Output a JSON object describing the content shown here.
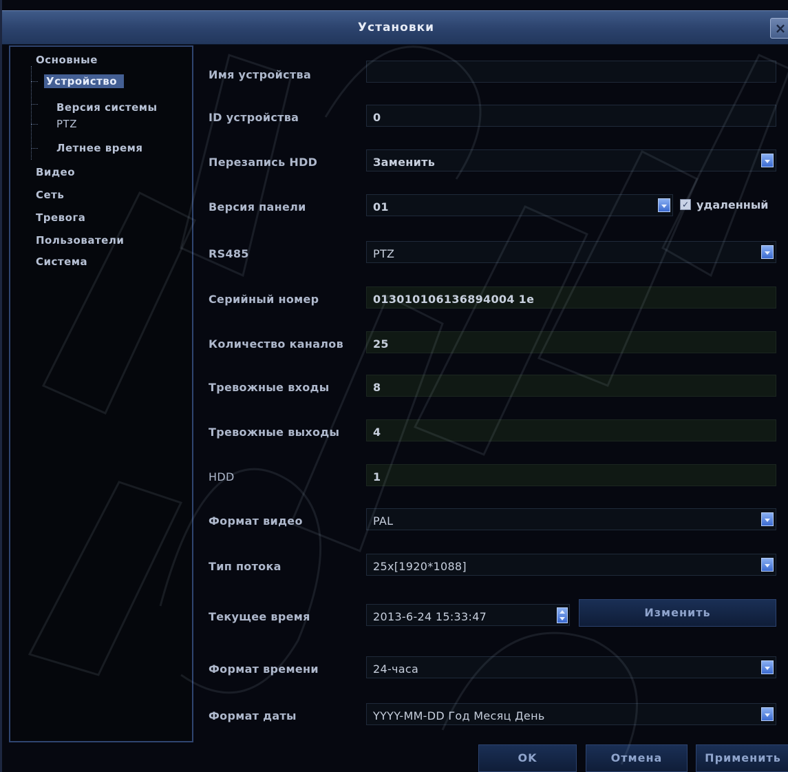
{
  "window": {
    "title": "Установки",
    "close_symbol": "×"
  },
  "sidebar": {
    "items": [
      {
        "label": "Основные"
      },
      {
        "label": "Устройство"
      },
      {
        "label": "Версия системы"
      },
      {
        "label": "PTZ"
      },
      {
        "label": "Летнее время"
      },
      {
        "label": "Видео"
      },
      {
        "label": "Сеть"
      },
      {
        "label": "Тревога"
      },
      {
        "label": "Пользователи"
      },
      {
        "label": "Система"
      }
    ]
  },
  "form": {
    "device_name": {
      "label": "Имя устройства",
      "value": ""
    },
    "device_id": {
      "label": "ID устройства",
      "value": "0"
    },
    "hdd_overwrite": {
      "label": "Перезапись HDD",
      "value": "Заменить"
    },
    "panel_version": {
      "label": "Версия панели",
      "value": "01",
      "remote_label": "удаленный",
      "remote_checked": true
    },
    "rs485": {
      "label": "RS485",
      "value": "PTZ"
    },
    "serial": {
      "label": "Серийный номер",
      "value": "013010106136894004 1e"
    },
    "channels": {
      "label": "Количество каналов",
      "value": "25"
    },
    "alarm_in": {
      "label": "Тревожные входы",
      "value": "8"
    },
    "alarm_out": {
      "label": "Тревожные выходы",
      "value": "4"
    },
    "hdd": {
      "label": "HDD",
      "value": "1"
    },
    "video_format": {
      "label": "Формат видео",
      "value": "PAL"
    },
    "stream_type": {
      "label": "Тип потока",
      "value": "25x[1920*1088]"
    },
    "current_time": {
      "label": "Текущее время",
      "value": "2013-6-24 15:33:47",
      "change_label": "Изменить"
    },
    "time_format": {
      "label": "Формат времени",
      "value": "24-часа"
    },
    "date_format": {
      "label": "Формат даты",
      "value": "YYYY-MM-DD Год Месяц День"
    }
  },
  "footer": {
    "ok_label": "OK",
    "cancel_label": "Отмена",
    "apply_label": "Применить"
  },
  "colors": {
    "titlebar": "#2b426c",
    "selection": "#445f94",
    "accent": "#3b6ad0"
  }
}
